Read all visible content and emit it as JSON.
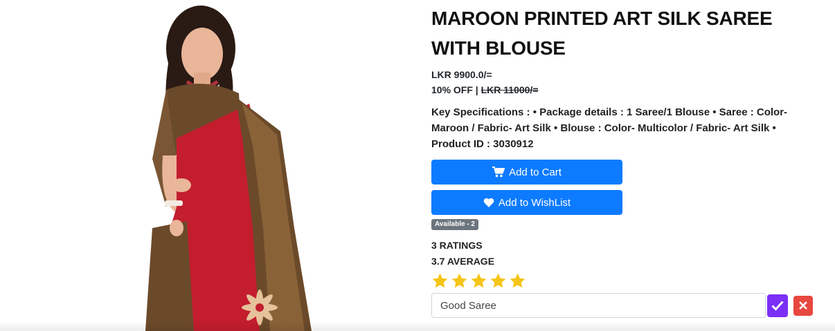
{
  "product": {
    "title": "MAROON PRINTED ART SILK SAREE WITH BLOUSE",
    "price": "LKR 9900.0/=",
    "discount_label": "10% OFF | ",
    "original_price": "LKR 11000/=",
    "specifications": "Key Specifications : • Package details : 1 Saree/1 Blouse • Saree : Color- Maroon / Fabric- Art Silk • Blouse : Color- Multicolor / Fabric- Art Silk • Product ID : 3030912",
    "image_icon": "saree-model-photo"
  },
  "actions": {
    "add_to_cart": "Add to Cart",
    "add_to_cart_icon": "cart-icon",
    "add_to_wishlist": "Add to WishList",
    "add_to_wishlist_icon": "heart-icon"
  },
  "availability": "Available - 2",
  "ratings": {
    "count_label": "3 RATINGS",
    "average_label": "3.7 AVERAGE",
    "stars_filled": 5,
    "stars_total": 5
  },
  "review": {
    "value": "Good Saree",
    "submit_icon": "check-icon",
    "cancel_icon": "close-icon"
  },
  "colors": {
    "primary": "#0d7bff",
    "star": "#f5c518",
    "submit": "#7b2ff7",
    "cancel": "#e8473f",
    "badge": "#6c757d"
  }
}
